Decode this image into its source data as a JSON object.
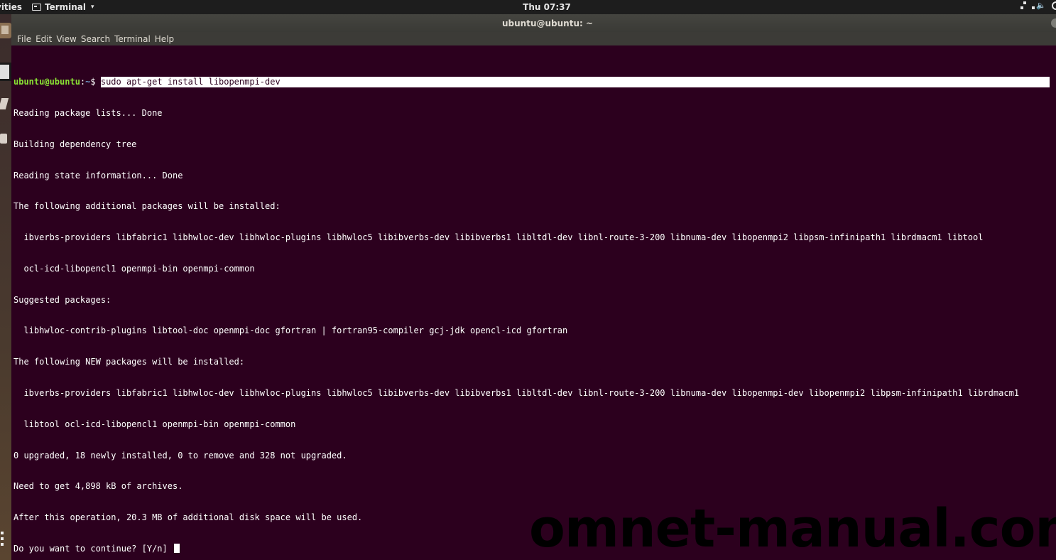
{
  "top_bar": {
    "activities_label": "vities",
    "app_menu_label": "Terminal",
    "app_menu_caret": "▾",
    "clock": "Thu 07:37",
    "tray_icons": [
      "network-icon",
      "volume-icon",
      "power-icon"
    ]
  },
  "window": {
    "title": "ubuntu@ubuntu: ~"
  },
  "menu": {
    "items": [
      "File",
      "Edit",
      "View",
      "Search",
      "Terminal",
      "Help"
    ]
  },
  "terminal": {
    "prompt_user": "ubuntu@ubuntu",
    "prompt_colon": ":",
    "prompt_path": "~",
    "prompt_symbol": "$ ",
    "command": "sudo apt-get install libopenmpi-dev",
    "output_lines": [
      "Reading package lists... Done",
      "Building dependency tree",
      "Reading state information... Done",
      "The following additional packages will be installed:",
      "  ibverbs-providers libfabric1 libhwloc-dev libhwloc-plugins libhwloc5 libibverbs-dev libibverbs1 libltdl-dev libnl-route-3-200 libnuma-dev libopenmpi2 libpsm-infinipath1 librdmacm1 libtool",
      "  ocl-icd-libopencl1 openmpi-bin openmpi-common",
      "Suggested packages:",
      "  libhwloc-contrib-plugins libtool-doc openmpi-doc gfortran | fortran95-compiler gcj-jdk opencl-icd gfortran",
      "The following NEW packages will be installed:",
      "  ibverbs-providers libfabric1 libhwloc-dev libhwloc-plugins libhwloc5 libibverbs-dev libibverbs1 libltdl-dev libnl-route-3-200 libnuma-dev libopenmpi-dev libopenmpi2 libpsm-infinipath1 librdmacm1",
      "  libtool ocl-icd-libopencl1 openmpi-bin openmpi-common",
      "0 upgraded, 18 newly installed, 0 to remove and 328 not upgraded.",
      "Need to get 4,898 kB of archives.",
      "After this operation, 20.3 MB of additional disk space will be used."
    ],
    "final_prompt": "Do you want to continue? [Y/n] "
  },
  "watermark": "omnet-manual.com",
  "colors": {
    "terminal_bg": "#2c001e",
    "prompt_user": "#8ae234",
    "prompt_path": "#729fcf",
    "text": "#ffffff"
  }
}
